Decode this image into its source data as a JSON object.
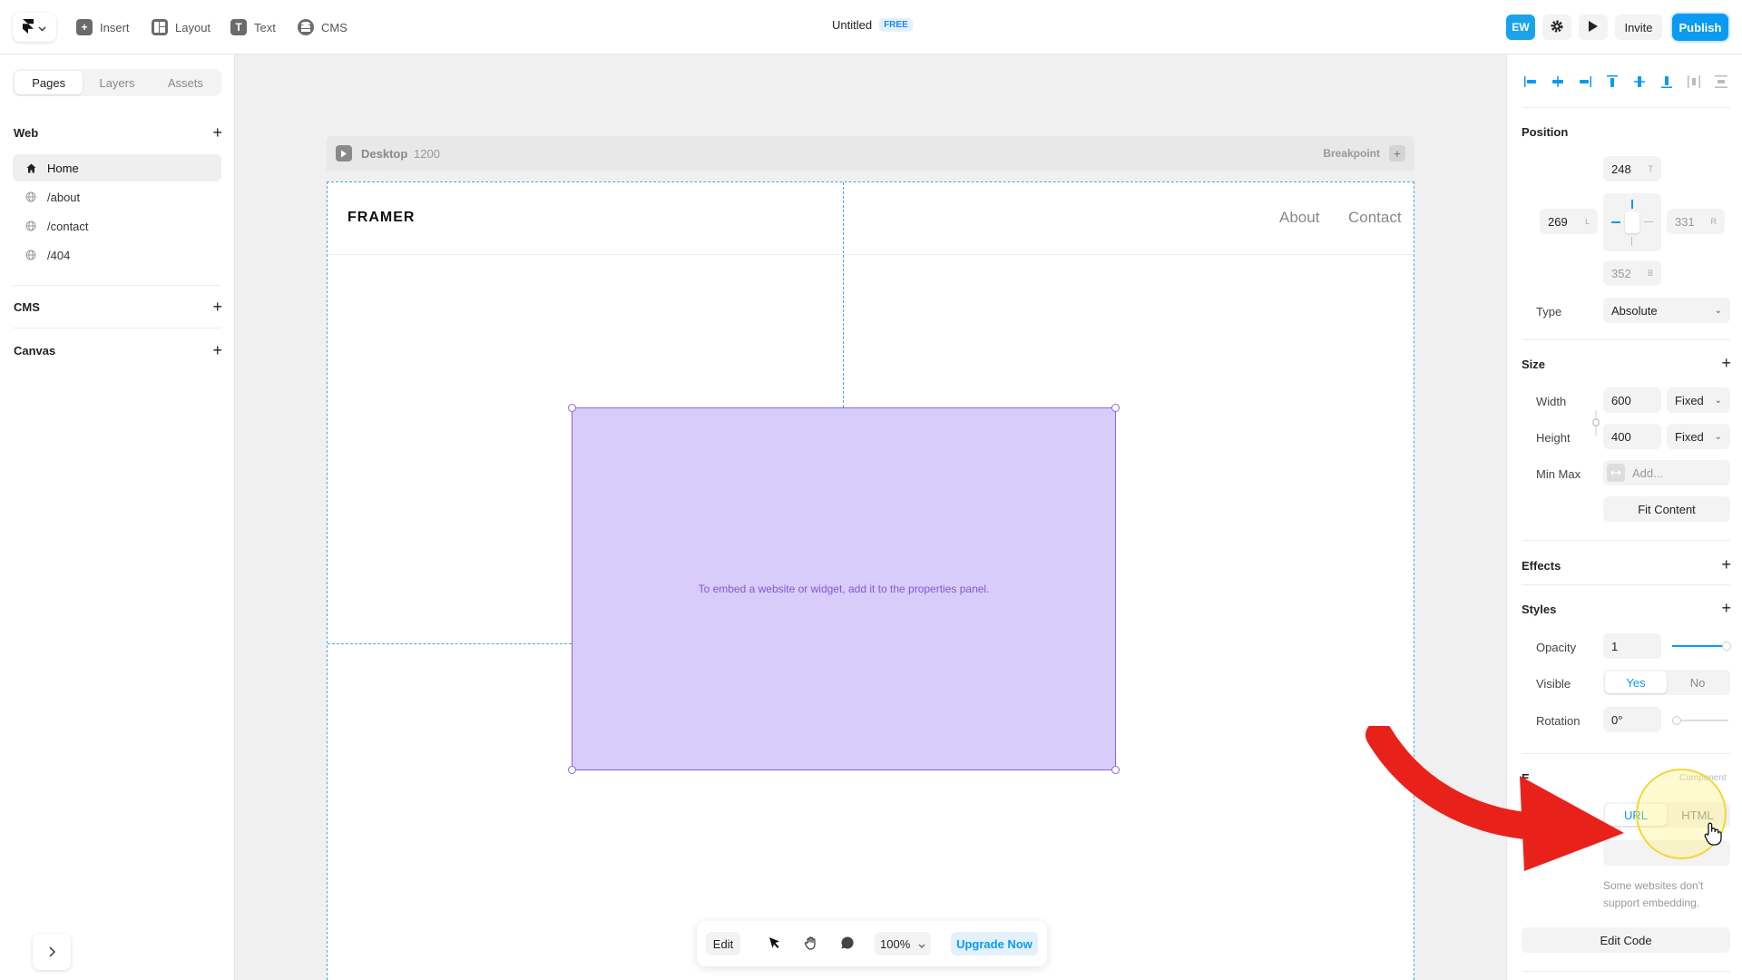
{
  "topbar": {
    "tools": [
      {
        "label": "Insert",
        "icon": "plus-icon"
      },
      {
        "label": "Layout",
        "icon": "layout-icon"
      },
      {
        "label": "Text",
        "icon": "text-icon"
      },
      {
        "label": "CMS",
        "icon": "cms-icon"
      }
    ],
    "title": "Untitled",
    "plan_badge": "FREE",
    "avatar_initials": "EW",
    "invite_label": "Invite",
    "publish_label": "Publish"
  },
  "left_panel": {
    "tabs": [
      "Pages",
      "Layers",
      "Assets"
    ],
    "active_tab": "Pages",
    "web_section": "Web",
    "pages": [
      {
        "label": "Home",
        "icon": "home-icon",
        "active": true
      },
      {
        "label": "/about",
        "icon": "globe-icon",
        "active": false
      },
      {
        "label": "/contact",
        "icon": "globe-icon",
        "active": false
      },
      {
        "label": "/404",
        "icon": "globe-icon",
        "active": false
      }
    ],
    "cms_section": "CMS",
    "canvas_section": "Canvas"
  },
  "canvas": {
    "breakpoint_label": "Desktop",
    "breakpoint_width": "1200",
    "breakpoint_add_label": "Breakpoint",
    "site_brand": "FRAMER",
    "nav_links": [
      "About",
      "Contact"
    ],
    "embed_message": "To embed a website or widget, add it to the properties panel."
  },
  "bottom_toolbar": {
    "edit_label": "Edit",
    "zoom": "100%",
    "upgrade_label": "Upgrade Now"
  },
  "right_panel": {
    "position": {
      "title": "Position",
      "top": "248",
      "top_suffix": "T",
      "left": "269",
      "left_suffix": "L",
      "right": "331",
      "right_suffix": "R",
      "bottom": "352",
      "bottom_suffix": "B",
      "type_label": "Type",
      "type_value": "Absolute"
    },
    "size": {
      "title": "Size",
      "width_label": "Width",
      "width_value": "600",
      "width_mode": "Fixed",
      "height_label": "Height",
      "height_value": "400",
      "height_mode": "Fixed",
      "minmax_label": "Min Max",
      "minmax_placeholder": "Add...",
      "fit_content_label": "Fit Content"
    },
    "effects_title": "Effects",
    "styles": {
      "title": "Styles",
      "opacity_label": "Opacity",
      "opacity_value": "1",
      "visible_label": "Visible",
      "visible_options": [
        "Yes",
        "No"
      ],
      "visible_selected": "Yes",
      "rotation_label": "Rotation",
      "rotation_value": "0°"
    },
    "embed": {
      "title_partial": "E",
      "component_label": "Component",
      "mode_options": [
        "URL",
        "HTML"
      ],
      "mode_selected": "URL",
      "url_label_partial": "RL",
      "helper_text": "Some websites don't support embedding.",
      "edit_code_label": "Edit Code"
    }
  },
  "colors": {
    "accent": "#0a9af0",
    "embed_fill": "#d8ccfb",
    "embed_border": "#8a63e6",
    "annotation_arrow": "#e8221b"
  }
}
